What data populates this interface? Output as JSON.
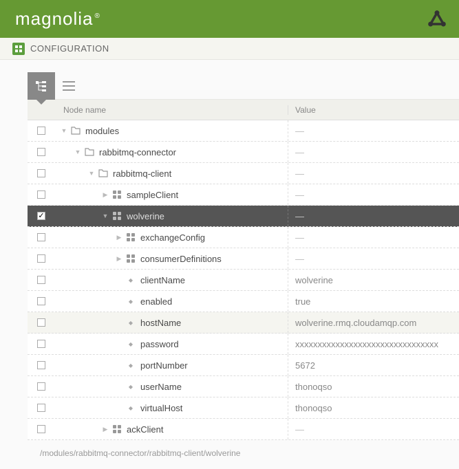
{
  "header": {
    "logo_text": "magnolia"
  },
  "breadcrumb": {
    "label": "CONFIGURATION"
  },
  "columns": {
    "name": "Node name",
    "value": "Value"
  },
  "rows": [
    {
      "indent": 0,
      "expand": "expanded",
      "icon": "folder",
      "label": "modules",
      "value": "—",
      "dash": true
    },
    {
      "indent": 1,
      "expand": "expanded",
      "icon": "folder",
      "label": "rabbitmq-connector",
      "value": "—",
      "dash": true
    },
    {
      "indent": 2,
      "expand": "expanded",
      "icon": "folder",
      "label": "rabbitmq-client",
      "value": "—",
      "dash": true
    },
    {
      "indent": 3,
      "expand": "collapsed",
      "icon": "content",
      "label": "sampleClient",
      "value": "—",
      "dash": true
    },
    {
      "indent": 3,
      "expand": "expanded",
      "icon": "content",
      "label": "wolverine",
      "value": "—",
      "dash": true,
      "selected": true
    },
    {
      "indent": 4,
      "expand": "collapsed",
      "icon": "content",
      "label": "exchangeConfig",
      "value": "—",
      "dash": true
    },
    {
      "indent": 4,
      "expand": "collapsed",
      "icon": "content",
      "label": "consumerDefinitions",
      "value": "—",
      "dash": true
    },
    {
      "indent": 4,
      "expand": "none",
      "icon": "prop",
      "label": "clientName",
      "value": "wolverine"
    },
    {
      "indent": 4,
      "expand": "none",
      "icon": "prop",
      "label": "enabled",
      "value": "true"
    },
    {
      "indent": 4,
      "expand": "none",
      "icon": "prop",
      "label": "hostName",
      "value": "wolverine.rmq.cloudamqp.com",
      "hover": true
    },
    {
      "indent": 4,
      "expand": "none",
      "icon": "prop",
      "label": "password",
      "value": "xxxxxxxxxxxxxxxxxxxxxxxxxxxxxxxx"
    },
    {
      "indent": 4,
      "expand": "none",
      "icon": "prop",
      "label": "portNumber",
      "value": "5672"
    },
    {
      "indent": 4,
      "expand": "none",
      "icon": "prop",
      "label": "userName",
      "value": "thonoqso"
    },
    {
      "indent": 4,
      "expand": "none",
      "icon": "prop",
      "label": "virtualHost",
      "value": "thonoqso"
    },
    {
      "indent": 3,
      "expand": "collapsed",
      "icon": "content",
      "label": "ackClient",
      "value": "—",
      "dash": true
    }
  ],
  "footer_path": "/modules/rabbitmq-connector/rabbitmq-client/wolverine"
}
